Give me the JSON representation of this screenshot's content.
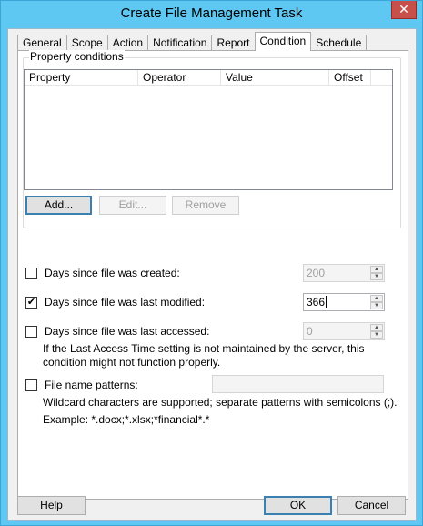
{
  "window": {
    "title": "Create File Management Task",
    "close_glyph": "✕",
    "accent": "#5ec8f2",
    "close_color": "#c7504a"
  },
  "tabs": [
    {
      "label": "General",
      "active": false
    },
    {
      "label": "Scope",
      "active": false
    },
    {
      "label": "Action",
      "active": false
    },
    {
      "label": "Notification",
      "active": false
    },
    {
      "label": "Report",
      "active": false
    },
    {
      "label": "Condition",
      "active": true
    },
    {
      "label": "Schedule",
      "active": false
    }
  ],
  "property_conditions": {
    "group_label": "Property conditions",
    "columns": [
      "Property",
      "Operator",
      "Value",
      "Offset"
    ],
    "rows": [],
    "buttons": {
      "add": "Add...",
      "edit": "Edit...",
      "remove": "Remove"
    }
  },
  "conditions": {
    "created": {
      "label": "Days since file was created:",
      "checked": false,
      "value": "200"
    },
    "modified": {
      "label": "Days since file was last modified:",
      "checked": true,
      "value": "366"
    },
    "accessed": {
      "label": "Days since file was last accessed:",
      "checked": false,
      "value": "0",
      "note_line1": "If the Last Access Time setting is not maintained by the server, this",
      "note_line2": "condition might not function properly."
    },
    "patterns": {
      "label": "File name patterns:",
      "checked": false,
      "value": "",
      "note_line1": "Wildcard characters are supported; separate patterns with semicolons (;).",
      "note_line2": "Example: *.docx;*.xlsx;*financial*.*"
    }
  },
  "footer": {
    "help": "Help",
    "ok": "OK",
    "cancel": "Cancel"
  }
}
